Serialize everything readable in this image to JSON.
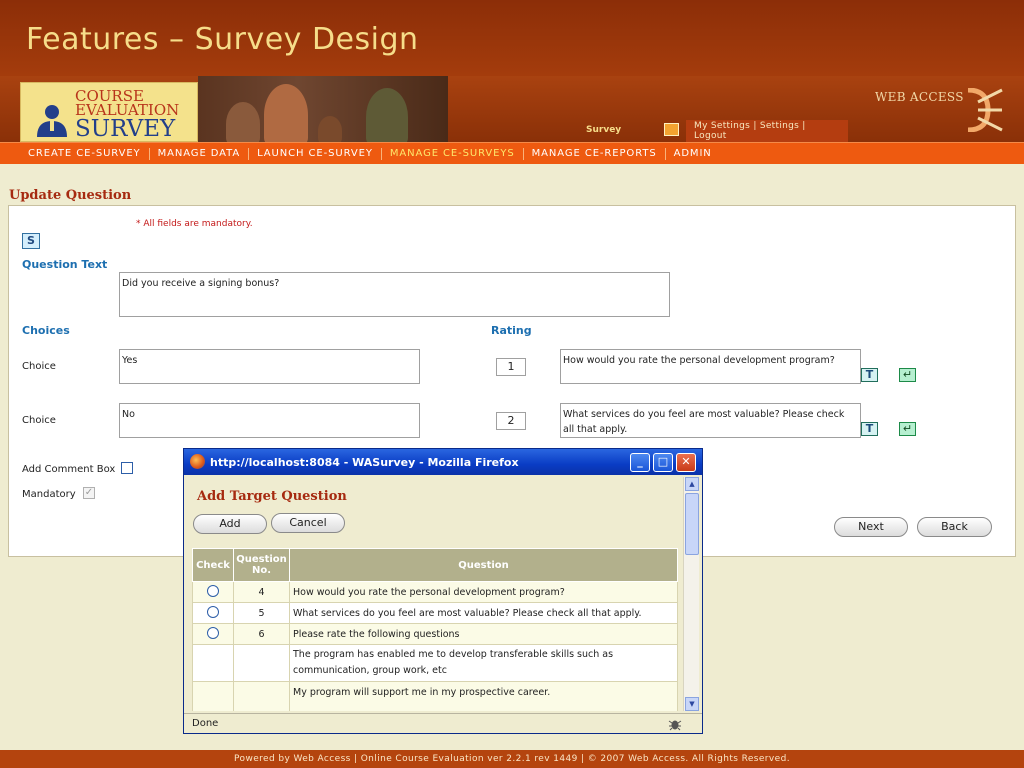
{
  "page": {
    "title": "Features – Survey Design"
  },
  "header": {
    "logo": {
      "line1": "COURSE",
      "line2": "EVALUATION",
      "line3": "SURVEY"
    },
    "survey_label": "Survey",
    "settings_text": "My Settings | Settings | Logout",
    "brand": "WEB ACCESS"
  },
  "nav": {
    "items": [
      {
        "label": "CREATE CE-SURVEY"
      },
      {
        "label": "MANAGE DATA"
      },
      {
        "label": "LAUNCH CE-SURVEY"
      },
      {
        "label": "MANAGE CE-SURVEYS",
        "active": true
      },
      {
        "label": "MANAGE CE-REPORTS"
      },
      {
        "label": "ADMIN"
      }
    ]
  },
  "form": {
    "heading": "Update Question",
    "mandatory_note": "* All fields are mandatory.",
    "s_button": "S",
    "question_text_label": "Question Text",
    "question_text_value": "Did you receive a signing bonus?",
    "choices_label": "Choices",
    "rating_label": "Rating",
    "choices": [
      {
        "label": "Choice",
        "value": "Yes",
        "rating": "1",
        "target": "How would you rate the personal development program?"
      },
      {
        "label": "Choice",
        "value": "No",
        "rating": "2",
        "target": "What services do you feel are most valuable? Please check all that apply."
      }
    ],
    "t_button": "T",
    "add_comment_label": "Add Comment Box",
    "mandatory_label": "Mandatory",
    "mandatory_checked": "✓",
    "next_label": "Next",
    "back_label": "Back"
  },
  "popup": {
    "window_title": "http://localhost:8084 - WASurvey - Mozilla Firefox",
    "heading": "Add Target Question",
    "add_label": "Add",
    "cancel_label": "Cancel",
    "columns": {
      "check": "Check",
      "number": "Question No.",
      "question": "Question"
    },
    "rows": [
      {
        "number": "4",
        "question": "How would you rate the personal development program?",
        "radio": true
      },
      {
        "number": "5",
        "question": "What services do you feel are most valuable? Please check all that apply.",
        "radio": true
      },
      {
        "number": "6",
        "question": "Please rate the following questions",
        "radio": true
      },
      {
        "number": "",
        "question": "The program has enabled me to develop transferable skills such as communication, group work, etc",
        "radio": false
      },
      {
        "number": "",
        "question": "My program will support me in my prospective career.",
        "radio": false
      }
    ],
    "status": "Done"
  },
  "footer": {
    "text": "Powered by Web Access | Online Course Evaluation ver 2.2.1 rev 1449 | © 2007 Web Access. All Rights Reserved."
  },
  "colors": {
    "brand_dark": "#8c2e08",
    "nav_orange": "#ee5a10",
    "heading_red": "#a62a10",
    "label_blue": "#1d6fb0"
  }
}
